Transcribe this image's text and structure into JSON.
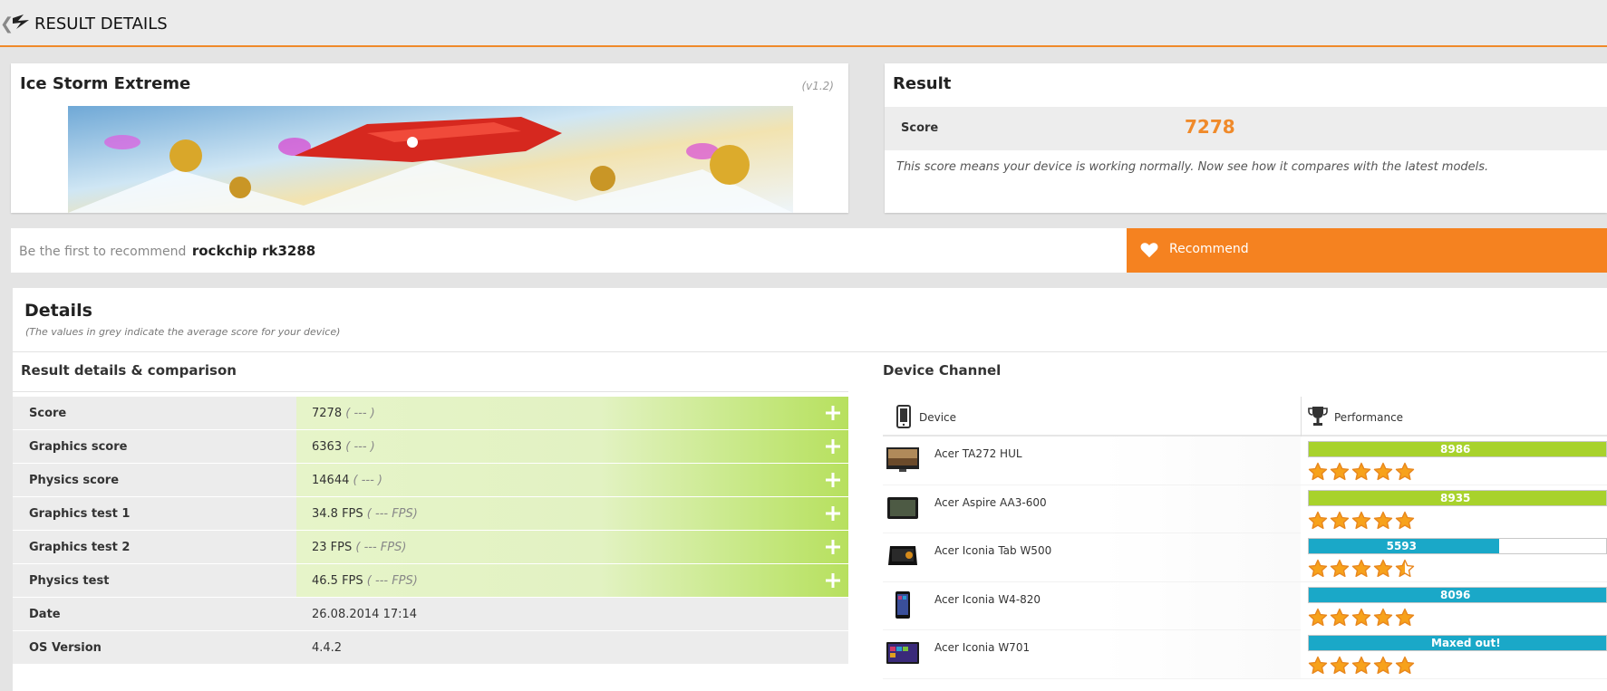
{
  "header": {
    "back": "❮",
    "title": "RESULT DETAILS"
  },
  "test": {
    "name": "Ice Storm Extreme",
    "version": "(v1.2)"
  },
  "result": {
    "title": "Result",
    "score_label": "Score",
    "score_value": "7278",
    "note": "This score means your device is working normally. Now see how it compares with the latest models."
  },
  "recommend": {
    "prefix": "Be the first to recommend",
    "device": "rockchip rk3288",
    "button_label": "Recommend"
  },
  "details": {
    "title": "Details",
    "subtitle": "(The values in grey indicate the average score for your device)",
    "left_title": "Result details & comparison",
    "right_title": "Device Channel",
    "rows": [
      {
        "label": "Score",
        "value": "7278",
        "avg": "( --- )",
        "style": "green"
      },
      {
        "label": "Graphics score",
        "value": "6363",
        "avg": "( --- )",
        "style": "green"
      },
      {
        "label": "Physics score",
        "value": "14644",
        "avg": "( --- )",
        "style": "green"
      },
      {
        "label": "Graphics test 1",
        "value": "34.8 FPS",
        "avg": "( --- FPS)",
        "style": "green"
      },
      {
        "label": "Graphics test 2",
        "value": "23 FPS",
        "avg": "( --- FPS)",
        "style": "green"
      },
      {
        "label": "Physics test",
        "value": "46.5 FPS",
        "avg": "( --- FPS)",
        "style": "green"
      },
      {
        "label": "Date",
        "value": "26.08.2014 17:14",
        "avg": "",
        "style": "grey"
      },
      {
        "label": "OS Version",
        "value": "4.4.2",
        "avg": "",
        "style": "grey"
      }
    ]
  },
  "device_channel": {
    "col_device": "Device",
    "col_performance": "Performance",
    "devices": [
      {
        "name": "Acer TA272 HUL",
        "bar_text": "8986",
        "bar_fraction": 1.0,
        "bar_color": "#a8d22c",
        "stars": 5,
        "thumb": "monitor"
      },
      {
        "name": "Acer Aspire AA3-600",
        "bar_text": "8935",
        "bar_fraction": 1.0,
        "bar_color": "#a8d22c",
        "stars": 5,
        "thumb": "tablet-dark"
      },
      {
        "name": "Acer Iconia Tab W500",
        "bar_text": "5593",
        "bar_fraction": 0.64,
        "bar_color": "#1aa8c8",
        "stars": 4.5,
        "thumb": "tablet-stand"
      },
      {
        "name": "Acer Iconia W4-820",
        "bar_text": "8096",
        "bar_fraction": 1.0,
        "bar_color": "#1aa8c8",
        "stars": 5,
        "thumb": "phone"
      },
      {
        "name": "Acer Iconia W701",
        "bar_text": "Maxed out!",
        "bar_fraction": 1.0,
        "bar_color": "#1aa8c8",
        "stars": 5,
        "thumb": "windows-tablet"
      }
    ]
  },
  "colors": {
    "accent": "#f58220",
    "score": "#f08a2a"
  },
  "icons": {
    "logo": "3dmark-logo-icon",
    "recommend": "heart-icon",
    "device": "phone-icon",
    "performance": "trophy-icon",
    "expand": "plus-icon",
    "rating": "star-icon"
  }
}
